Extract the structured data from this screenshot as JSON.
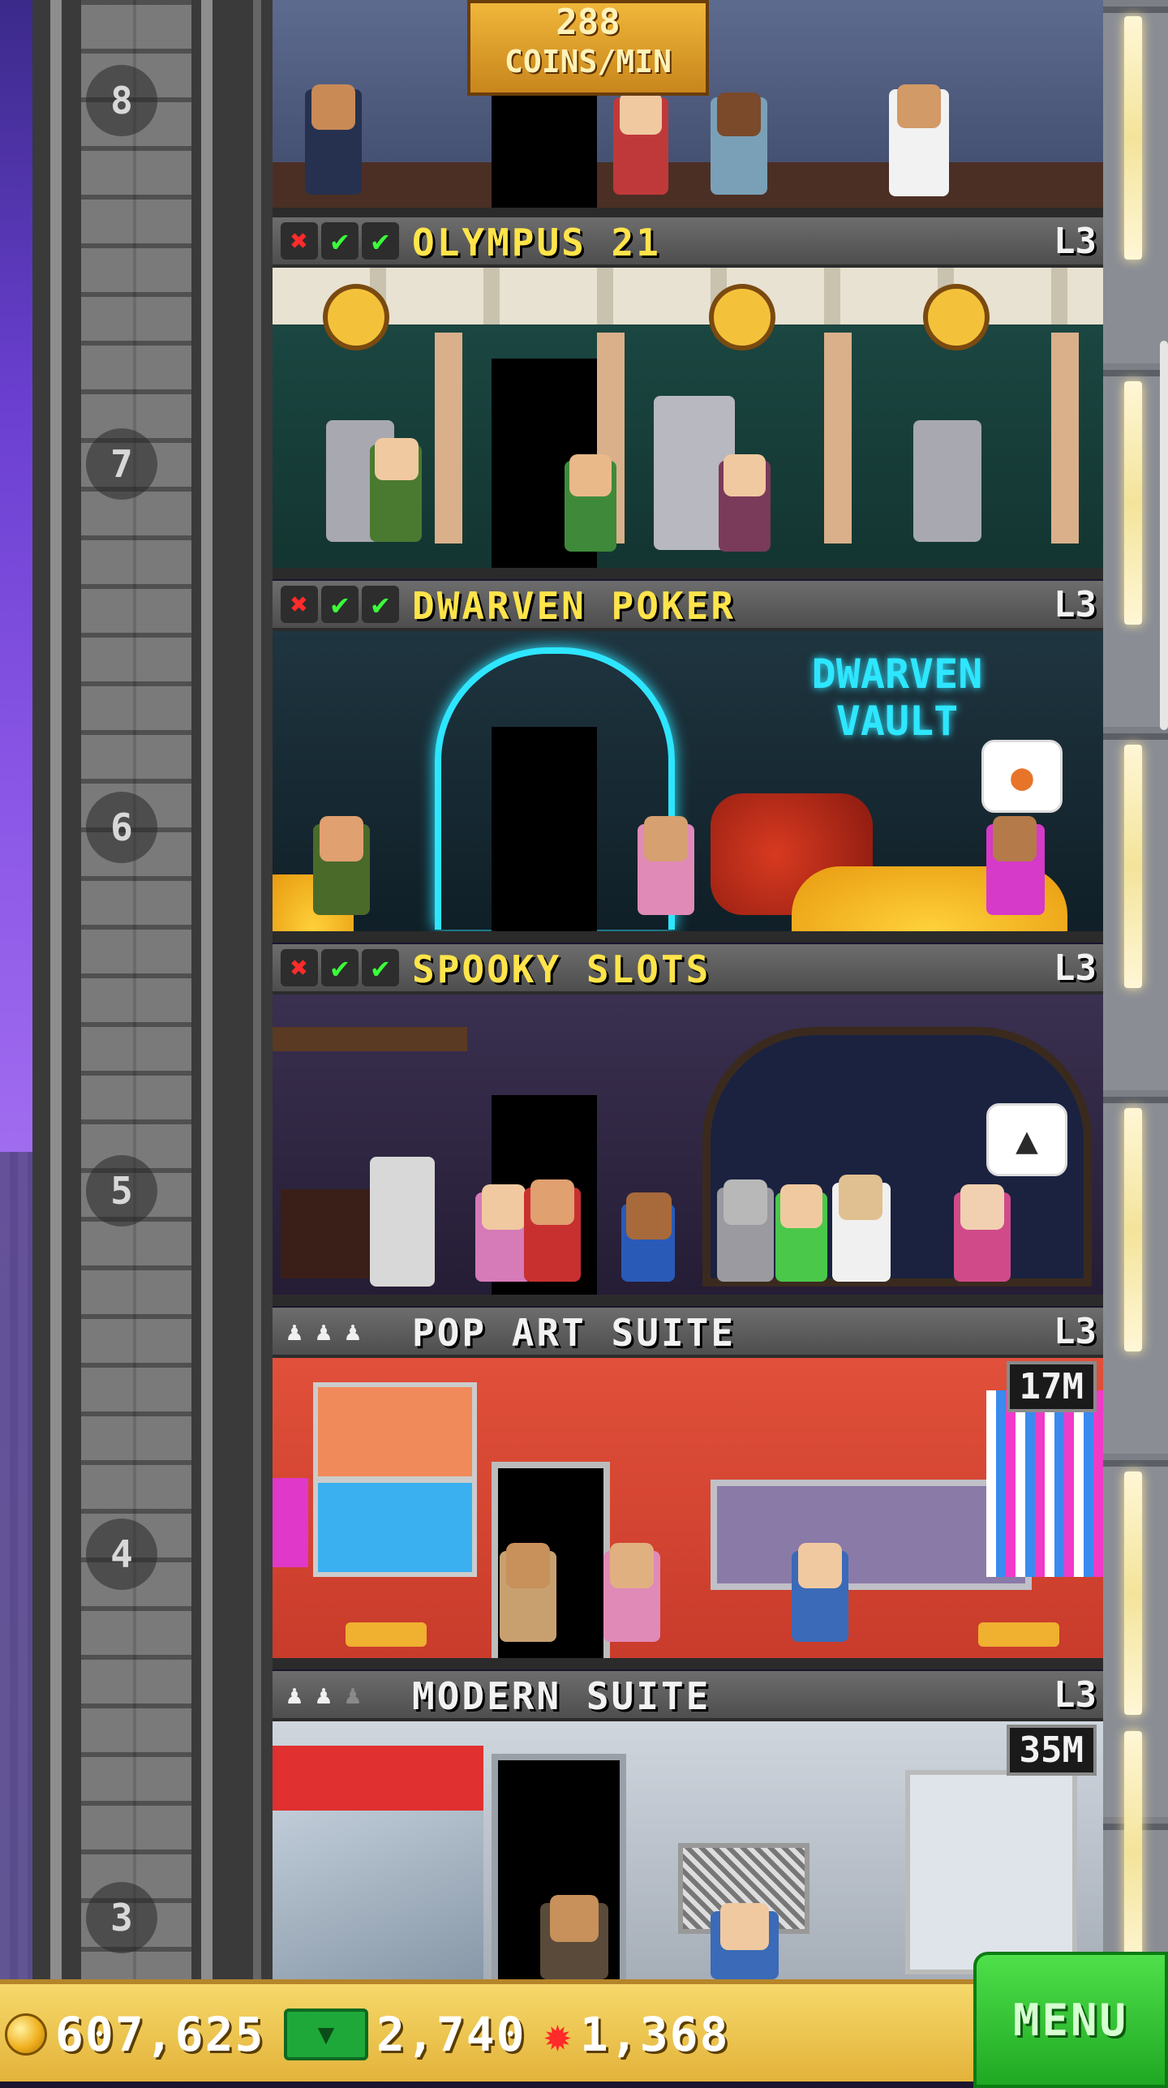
{
  "floors": {
    "f8": {
      "number": "8",
      "badge_amount": "288",
      "badge_unit": "COINS/MIN"
    },
    "f7": {
      "number": "7",
      "title": "OLYMPUS 21",
      "level": "L3"
    },
    "f6": {
      "number": "6",
      "title": "DWARVEN POKER",
      "level": "L3",
      "sign": "DWARVEN VAULT"
    },
    "f5": {
      "number": "5",
      "title": "SPOOKY SLOTS",
      "level": "L3"
    },
    "f4": {
      "number": "4",
      "title": "POP ART SUITE",
      "level": "L3",
      "price": "17M"
    },
    "f3": {
      "number": "3",
      "title": "MODERN SUITE",
      "level": "L3",
      "price": "35M"
    }
  },
  "status_icons": {
    "x": "✖",
    "check": "✔"
  },
  "bottom_bar": {
    "coins": "607,625",
    "bux": "2,740",
    "tokens": "1,368",
    "menu_label": "MENU"
  },
  "colors": {
    "title_yellow": "#ffe44a",
    "status_red": "#ff2b2b",
    "status_green": "#3aff3a",
    "menu_green": "#1fa823"
  }
}
